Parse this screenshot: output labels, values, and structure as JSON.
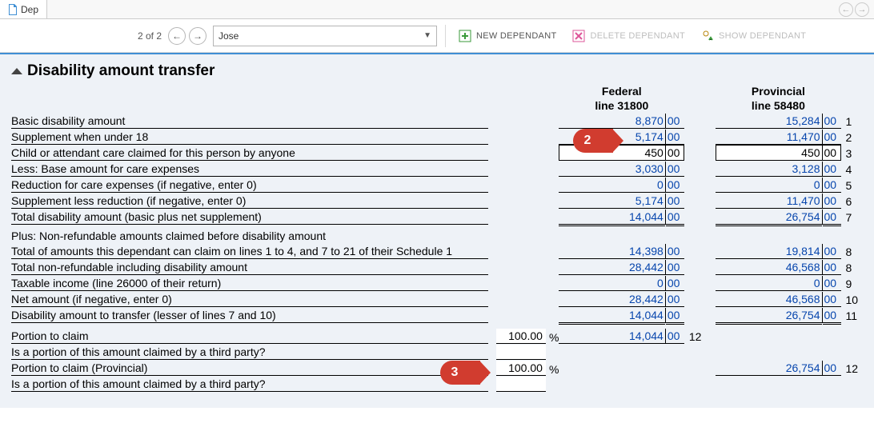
{
  "tab": {
    "label": "Dep"
  },
  "toolbar": {
    "pager": "2 of 2",
    "selected_name": "Jose",
    "new_dependant": "NEW DEPENDANT",
    "delete_dependant": "DELETE DEPENDANT",
    "show_dependant": "SHOW DEPENDANT"
  },
  "section_title": "Disability amount transfer",
  "headers": {
    "federal_title": "Federal",
    "federal_line": "line 31800",
    "provincial_title": "Provincial",
    "provincial_line": "line 58480"
  },
  "callouts": {
    "c2": "2",
    "c3": "3"
  },
  "rows": [
    {
      "label": "Basic disability amount",
      "fed_w": "8,870",
      "fed_c": "00",
      "prov_w": "15,284",
      "prov_c": "00",
      "num": "1",
      "link": true
    },
    {
      "label": "Supplement when under 18",
      "fed_w": "5,174",
      "fed_c": "00",
      "prov_w": "11,470",
      "prov_c": "00",
      "num": "2",
      "link": true
    },
    {
      "label": "Child or attendant care claimed for this person by anyone",
      "fed_w": "450",
      "fed_c": "00",
      "prov_w": "450",
      "prov_c": "00",
      "num": "3",
      "input": true
    },
    {
      "label": "Less: Base amount for care expenses",
      "fed_w": "3,030",
      "fed_c": "00",
      "prov_w": "3,128",
      "prov_c": "00",
      "num": "4",
      "link": true
    },
    {
      "label": "Reduction for care expenses (if negative, enter 0)",
      "fed_w": "0",
      "fed_c": "00",
      "prov_w": "0",
      "prov_c": "00",
      "num": "5",
      "link": true
    },
    {
      "label": "Supplement less reduction (if negative, enter 0)",
      "fed_w": "5,174",
      "fed_c": "00",
      "prov_w": "11,470",
      "prov_c": "00",
      "num": "6",
      "link": true
    },
    {
      "label": "Total disability amount (basic plus net supplement)",
      "fed_w": "14,044",
      "fed_c": "00",
      "prov_w": "26,754",
      "prov_c": "00",
      "num": "7",
      "link": true,
      "dbl": true
    },
    {
      "label": "Plus: Non-refundable amounts claimed before disability amount",
      "noamount": true
    },
    {
      "label": "Total of amounts this dependant can claim on lines 1 to 4, and 7 to 21 of their Schedule 1",
      "fed_w": "14,398",
      "fed_c": "00",
      "prov_w": "19,814",
      "prov_c": "00",
      "num": "8",
      "link": true
    },
    {
      "label": "Total non-refundable including disability amount",
      "fed_w": "28,442",
      "fed_c": "00",
      "prov_w": "46,568",
      "prov_c": "00",
      "num": "8",
      "link": true
    },
    {
      "label": "Taxable income (line 26000 of their return)",
      "fed_w": "0",
      "fed_c": "00",
      "prov_w": "0",
      "prov_c": "00",
      "num": "9",
      "link": true
    },
    {
      "label": "Net amount (if negative, enter 0)",
      "fed_w": "28,442",
      "fed_c": "00",
      "prov_w": "46,568",
      "prov_c": "00",
      "num": "10",
      "link": true
    },
    {
      "label": "Disability amount to transfer (lesser of lines 7 and 10)",
      "fed_w": "14,044",
      "fed_c": "00",
      "prov_w": "26,754",
      "prov_c": "00",
      "num": "11",
      "link": true,
      "dbl": true
    }
  ],
  "portion": {
    "claim_label": "Portion to claim",
    "claim_pct": "100.00",
    "pct_sym": "%",
    "third_party_label": "Is a portion of this amount claimed by a third party?",
    "claim_prov_label": "Portion to claim (Provincial)",
    "claim_prov_pct": "100.00",
    "third_party_prov_label": "Is a portion of this amount claimed by a third party?",
    "fed_w": "14,044",
    "fed_c": "00",
    "fed_num": "12",
    "prov_w": "26,754",
    "prov_c": "00",
    "prov_num": "12"
  }
}
